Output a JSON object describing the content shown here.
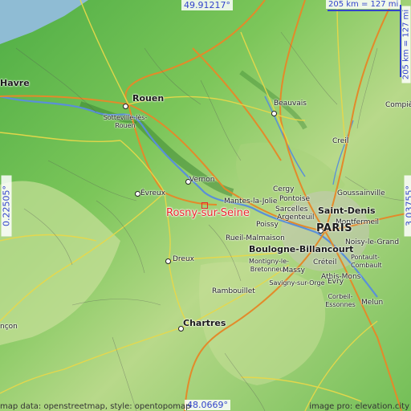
{
  "coordinates": {
    "top": "49.91217°",
    "bottom": "48.0669°",
    "left": "0.22505°",
    "right": "3.03755°"
  },
  "scale": {
    "horizontal": "205 km = 127 mi",
    "vertical": "205 km = 127 mi"
  },
  "highlight": {
    "name": "Rosny-sur-Seine",
    "color": "#e8262a"
  },
  "places": [
    {
      "name": "Havre"
    },
    {
      "name": "Rouen"
    },
    {
      "name": "Sotteville-lès-Rouen"
    },
    {
      "name": "Beauvais"
    },
    {
      "name": "Compiè"
    },
    {
      "name": "Creil"
    },
    {
      "name": "Vernon"
    },
    {
      "name": "Évreux"
    },
    {
      "name": "Mantes-la-Jolie"
    },
    {
      "name": "Cergy"
    },
    {
      "name": "Pontoise"
    },
    {
      "name": "Goussainville"
    },
    {
      "name": "Sarcelles"
    },
    {
      "name": "Argenteuil"
    },
    {
      "name": "Saint-Denis"
    },
    {
      "name": "Poissy"
    },
    {
      "name": "Montfermeil"
    },
    {
      "name": "PARIS"
    },
    {
      "name": "Rueil-Malmaison"
    },
    {
      "name": "Noisy-le-Grand"
    },
    {
      "name": "Boulogne-Billancourt"
    },
    {
      "name": "Dreux"
    },
    {
      "name": "Montigny-le-Bretonneux"
    },
    {
      "name": "Massy"
    },
    {
      "name": "Créteil"
    },
    {
      "name": "Pontault-Combault"
    },
    {
      "name": "Athis-Mons"
    },
    {
      "name": "Savigny-sur-Orge"
    },
    {
      "name": "Évry"
    },
    {
      "name": "Rambouillet"
    },
    {
      "name": "Corbeil-Essonnes"
    },
    {
      "name": "Melun"
    },
    {
      "name": "Chartres"
    },
    {
      "name": "nçon"
    }
  ],
  "attribution": {
    "left": "map data: openstreetmap, style: opentopomap",
    "right": "image pro: elevation.city"
  }
}
